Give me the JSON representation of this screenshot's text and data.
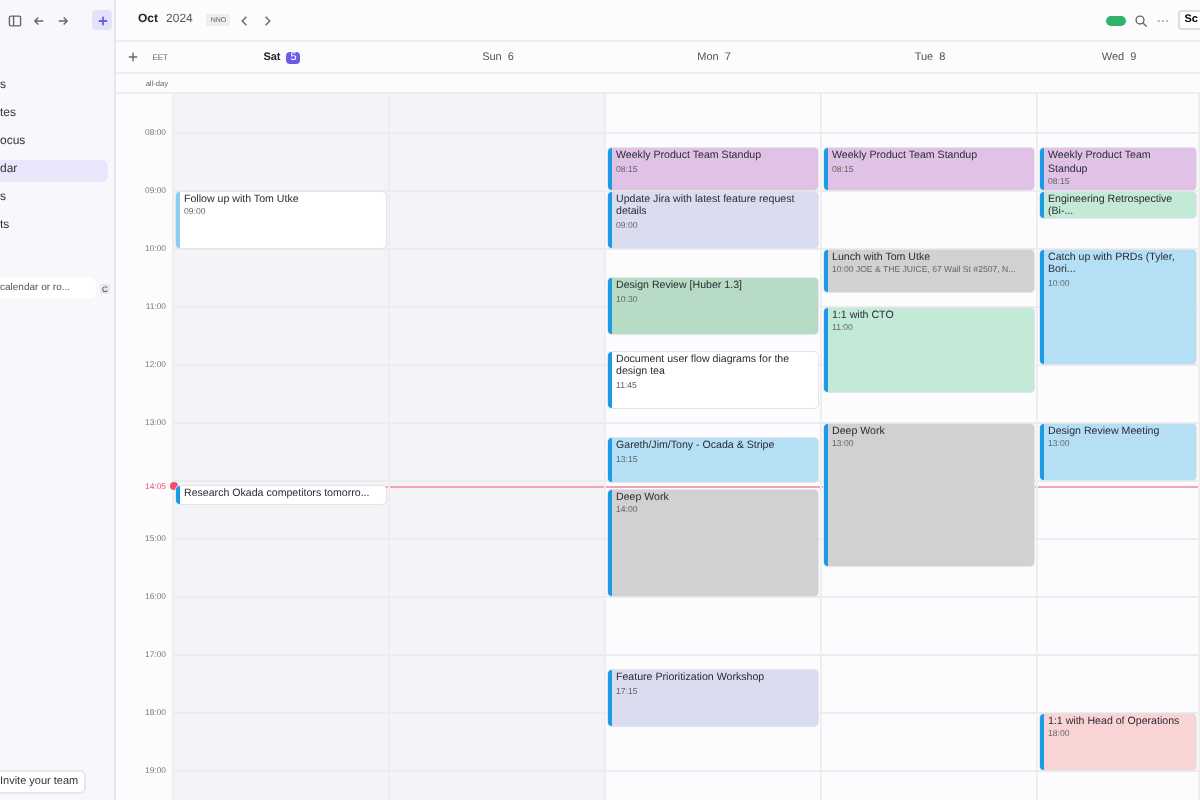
{
  "sidebar": {
    "items": [
      {
        "label": "s",
        "selected": false
      },
      {
        "label": "tes",
        "selected": false
      },
      {
        "label": "ocus",
        "selected": false
      },
      {
        "label": "dar",
        "selected": true
      },
      {
        "label": "s",
        "selected": false
      },
      {
        "label": "ts",
        "selected": false
      }
    ],
    "search": {
      "placeholder": "calendar or ro...",
      "shortcut": "C"
    },
    "invite": "Invite your team"
  },
  "toolbar": {
    "month": "Oct",
    "year": "2024",
    "badge": "NNO",
    "toggle_on": true,
    "button": "Sc"
  },
  "timezone": "EET",
  "all_day_label": "all-day",
  "hours": [
    "08:00",
    "09:00",
    "10:00",
    "11:00",
    "12:00",
    "13:00",
    "15:00",
    "16:00",
    "17:00",
    "18:00",
    "19:00"
  ],
  "now": {
    "time": "14:05"
  },
  "days": [
    {
      "weekday": "Sat",
      "date": "5",
      "today": true,
      "weekend": true,
      "events": [
        {
          "title": "Follow up with Tom Utke",
          "time": "09:00",
          "color": "#ffffff"
        },
        {
          "title": "Research Okada competitors tomorro...",
          "color": "#ffffff"
        }
      ]
    },
    {
      "weekday": "Sun",
      "date": "6",
      "today": false,
      "weekend": true
    },
    {
      "weekday": "Mon",
      "date": "7",
      "today": false,
      "weekend": false,
      "events": [
        {
          "title": "Weekly Product Team Standup",
          "time": "08:15",
          "color": "#dfc2e6"
        },
        {
          "title": "Update Jira with latest feature request details",
          "time": "09:00",
          "color": "#d9ddef"
        },
        {
          "title": "Design Review [Huber 1.3]",
          "time": "10:30",
          "color": "#b8dbc6"
        },
        {
          "title": "Document user flow diagrams for the design tea",
          "time": "11:45",
          "color": "#ffffff"
        },
        {
          "title": "Gareth/Jim/Tony - Ocada & Stripe",
          "time": "13:15",
          "color": "#b4dff4"
        },
        {
          "title": "Deep Work",
          "time": "14:00",
          "color": "#d1d1d1"
        },
        {
          "title": "Feature Prioritization Workshop",
          "time": "17:15",
          "color": "#d9ddef"
        }
      ]
    },
    {
      "weekday": "Tue",
      "date": "8",
      "today": false,
      "weekend": false,
      "events": [
        {
          "title": "Weekly Product Team Standup",
          "time": "08:15",
          "color": "#dfc2e6"
        },
        {
          "title": "Lunch with Tom Utke",
          "time": "10:00",
          "detail": "JOE & THE JUICE, 67 Wall St #2507, N...",
          "color": "#d1d1d1"
        },
        {
          "title": "1:1 with CTO",
          "time": "11:00",
          "color": "#c3e9d7"
        },
        {
          "title": "Deep Work",
          "time": "13:00",
          "color": "#d1d1d1"
        }
      ]
    },
    {
      "weekday": "Wed",
      "date": "9",
      "today": false,
      "weekend": false,
      "events": [
        {
          "title": "Weekly Product Team Standup",
          "time": "08:15",
          "color": "#dfc2e6"
        },
        {
          "title": "Engineering Retrospective (Bi-...",
          "color": "#c3e9d7"
        },
        {
          "title": "Catch up with PRDs (Tyler, Bori...",
          "time": "10:00",
          "color": "#b4dff4"
        },
        {
          "title": "Design Review Meeting",
          "time": "13:00",
          "color": "#b4dff4"
        },
        {
          "title": "1:1 with Head of Operations",
          "time": "18:00",
          "color": "#f8d4d4"
        }
      ]
    }
  ]
}
